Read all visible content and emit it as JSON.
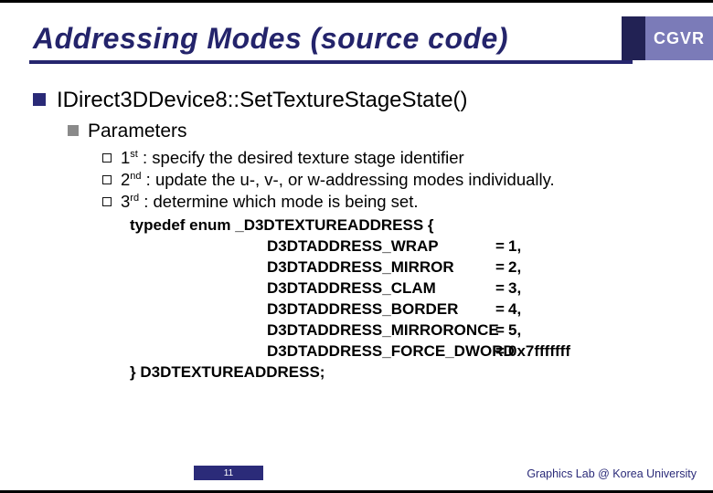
{
  "colors": {
    "accent": "#26266e",
    "badge_dark": "#222254",
    "badge_light": "#7b7bb8"
  },
  "title": "Addressing Modes (source code)",
  "badge": "CGVR",
  "heading": "IDirect3DDevice8::SetTextureStageState()",
  "sub": "Parameters",
  "params": [
    {
      "ord": "1",
      "suffix": "st",
      "text": " : specify the desired texture stage identifier"
    },
    {
      "ord": "2",
      "suffix": "nd",
      "text": " : update the u-, v-, or w-addressing modes individually."
    },
    {
      "ord": "3",
      "suffix": "rd",
      "text": " : determine which mode is being set."
    }
  ],
  "enum_open": "typedef enum _D3DTEXTUREADDRESS {",
  "enum_rows": [
    {
      "name": "D3DTADDRESS_WRAP",
      "val": "1,"
    },
    {
      "name": "D3DTADDRESS_MIRROR",
      "val": "2,"
    },
    {
      "name": "D3DTADDRESS_CLAM",
      "val": "3,"
    },
    {
      "name": "D3DTADDRESS_BORDER",
      "val": "4,"
    },
    {
      "name": "D3DTADDRESS_MIRRORONCE",
      "val": "5,"
    },
    {
      "name": "D3DTADDRESS_FORCE_DWORD",
      "val": "0x7fffffff"
    }
  ],
  "enum_close": "} D3DTEXTUREADDRESS;",
  "eq": "=",
  "page_number": "11",
  "footer": "Graphics Lab @ Korea University"
}
